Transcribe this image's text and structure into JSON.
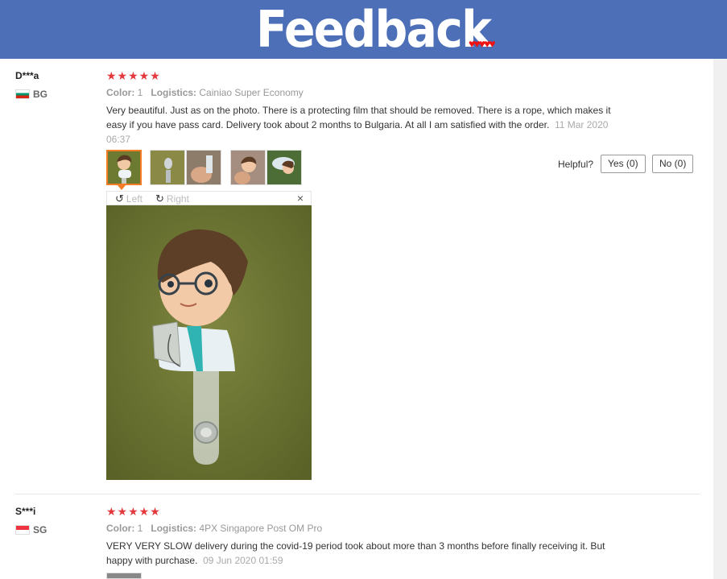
{
  "banner": {
    "title": "Feedback",
    "hearts": "♥♥♥♥♥"
  },
  "reviews": [
    {
      "user": "D***a",
      "country": "BG",
      "stars": "★★★★★",
      "color_label": "Color:",
      "color_value": "1",
      "logistics_label": "Logistics:",
      "logistics_value": "Cainiao Super Economy",
      "text": "Very beautiful. Just as on the photo. There is a protecting film that should be removed. There is a rope, which makes it easy if you have pass card. Delivery took about 2 months to Bulgaria. At all I am satisfied with the order.",
      "date": "11 Mar 2020 06:37",
      "helpful_label": "Helpful?",
      "yes_label": "Yes (0)",
      "no_label": "No (0)",
      "viewer": {
        "left_label": "Left",
        "right_label": "Right",
        "close": "×"
      }
    },
    {
      "user": "S***i",
      "country": "SG",
      "stars": "★★★★★",
      "color_label": "Color:",
      "color_value": "1",
      "logistics_label": "Logistics:",
      "logistics_value": "4PX Singapore Post OM Pro",
      "text": "VERY VERY SLOW delivery during the covid-19 period took about more than 3 months before finally receiving it. But happy with purchase.",
      "date": "09 Jun 2020 01:59"
    }
  ]
}
